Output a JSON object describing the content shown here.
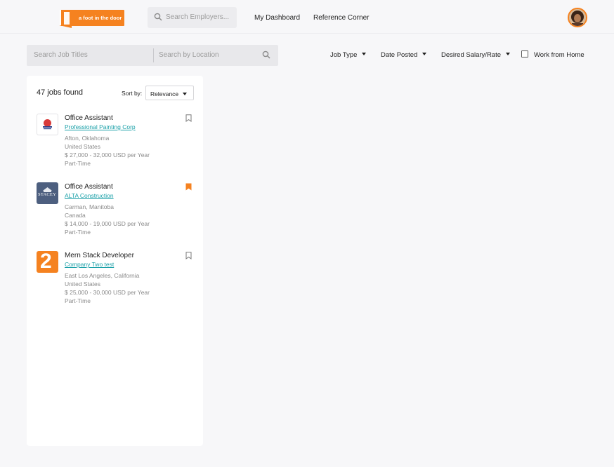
{
  "header": {
    "logo_text": "a foot in the door",
    "employer_search_placeholder": "Search Employers...",
    "nav": [
      "My Dashboard",
      "Reference Corner"
    ]
  },
  "search": {
    "job_title_placeholder": "Search Job Titles",
    "location_placeholder": "Search by Location"
  },
  "filters": {
    "job_type": "Job Type",
    "date_posted": "Date Posted",
    "salary": "Desired Salary/Rate",
    "wfh": "Work from Home",
    "wfh_checked": false
  },
  "results": {
    "count_label": "47 jobs found",
    "sort_label": "Sort by:",
    "sort_value": "Relevance"
  },
  "jobs": [
    {
      "title": "Office Assistant",
      "company": "Professional Painting Corp",
      "city": "Afton, Oklahoma",
      "country": "United States",
      "salary": "$ 27,000 - 32,000 USD per Year",
      "type": "Part-Time",
      "saved": false,
      "logo_icon": "painting-corp-logo"
    },
    {
      "title": "Office Assistant",
      "company": "ALTA Construction",
      "city": "Carman, Manitoba",
      "country": "Canada",
      "salary": "$ 14,000 - 19,000 USD per Year",
      "type": "Part-Time",
      "saved": true,
      "logo_icon": "stacey-logo",
      "logo_text": "STACEY"
    },
    {
      "title": "Mern Stack Developer",
      "company": "Company Two test",
      "city": "East Los Angeles, California",
      "country": "United States",
      "salary": "$ 25,000 - 30,000 USD per Year",
      "type": "Part-Time",
      "saved": false,
      "logo_icon": "company-two-logo",
      "logo_text": "2"
    }
  ],
  "colors": {
    "brand": "#f58220",
    "link": "#1aa0a8",
    "background": "#f7f7f9"
  }
}
